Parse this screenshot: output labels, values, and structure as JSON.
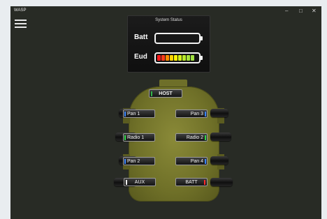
{
  "app": {
    "title": "WASP"
  },
  "window_controls": {
    "minimize": "–",
    "maximize": "□",
    "close": "✕"
  },
  "menu": {
    "icon": "hamburger-menu-icon"
  },
  "system_status": {
    "title": "System Status",
    "batt": {
      "label": "Batt",
      "level": 0
    },
    "eud": {
      "label": "Eud",
      "level": 1.0,
      "cell_colors": [
        "#ff1a1a",
        "#ff3b1a",
        "#ff8a00",
        "#ffd200",
        "#fff200",
        "#d4ef1c",
        "#b8e82a",
        "#a7e33a",
        "#a0e040"
      ]
    }
  },
  "ports": {
    "host": {
      "label": "HOST",
      "led_color": "#31b44a"
    },
    "pan1": {
      "label": "Pan 1",
      "led_color": "#3a86ff"
    },
    "pan3": {
      "label": "Pan 3",
      "led_color": "#3a86ff"
    },
    "radio1": {
      "label": "Radio 1",
      "led_color": "#31d84a"
    },
    "radio2": {
      "label": "Radio 2",
      "led_color": "#31d84a"
    },
    "pan2": {
      "label": "Pan 2",
      "led_color": "#3a86ff"
    },
    "pan4": {
      "label": "Pan 4",
      "led_color": "#3a86ff"
    },
    "aux": {
      "label": "AUX",
      "led_color": "#f2f2f2"
    },
    "batt": {
      "label": "BATT",
      "led_color": "#ff2a2a"
    }
  },
  "colors": {
    "background": "#282b25",
    "pcb": "#707029"
  }
}
